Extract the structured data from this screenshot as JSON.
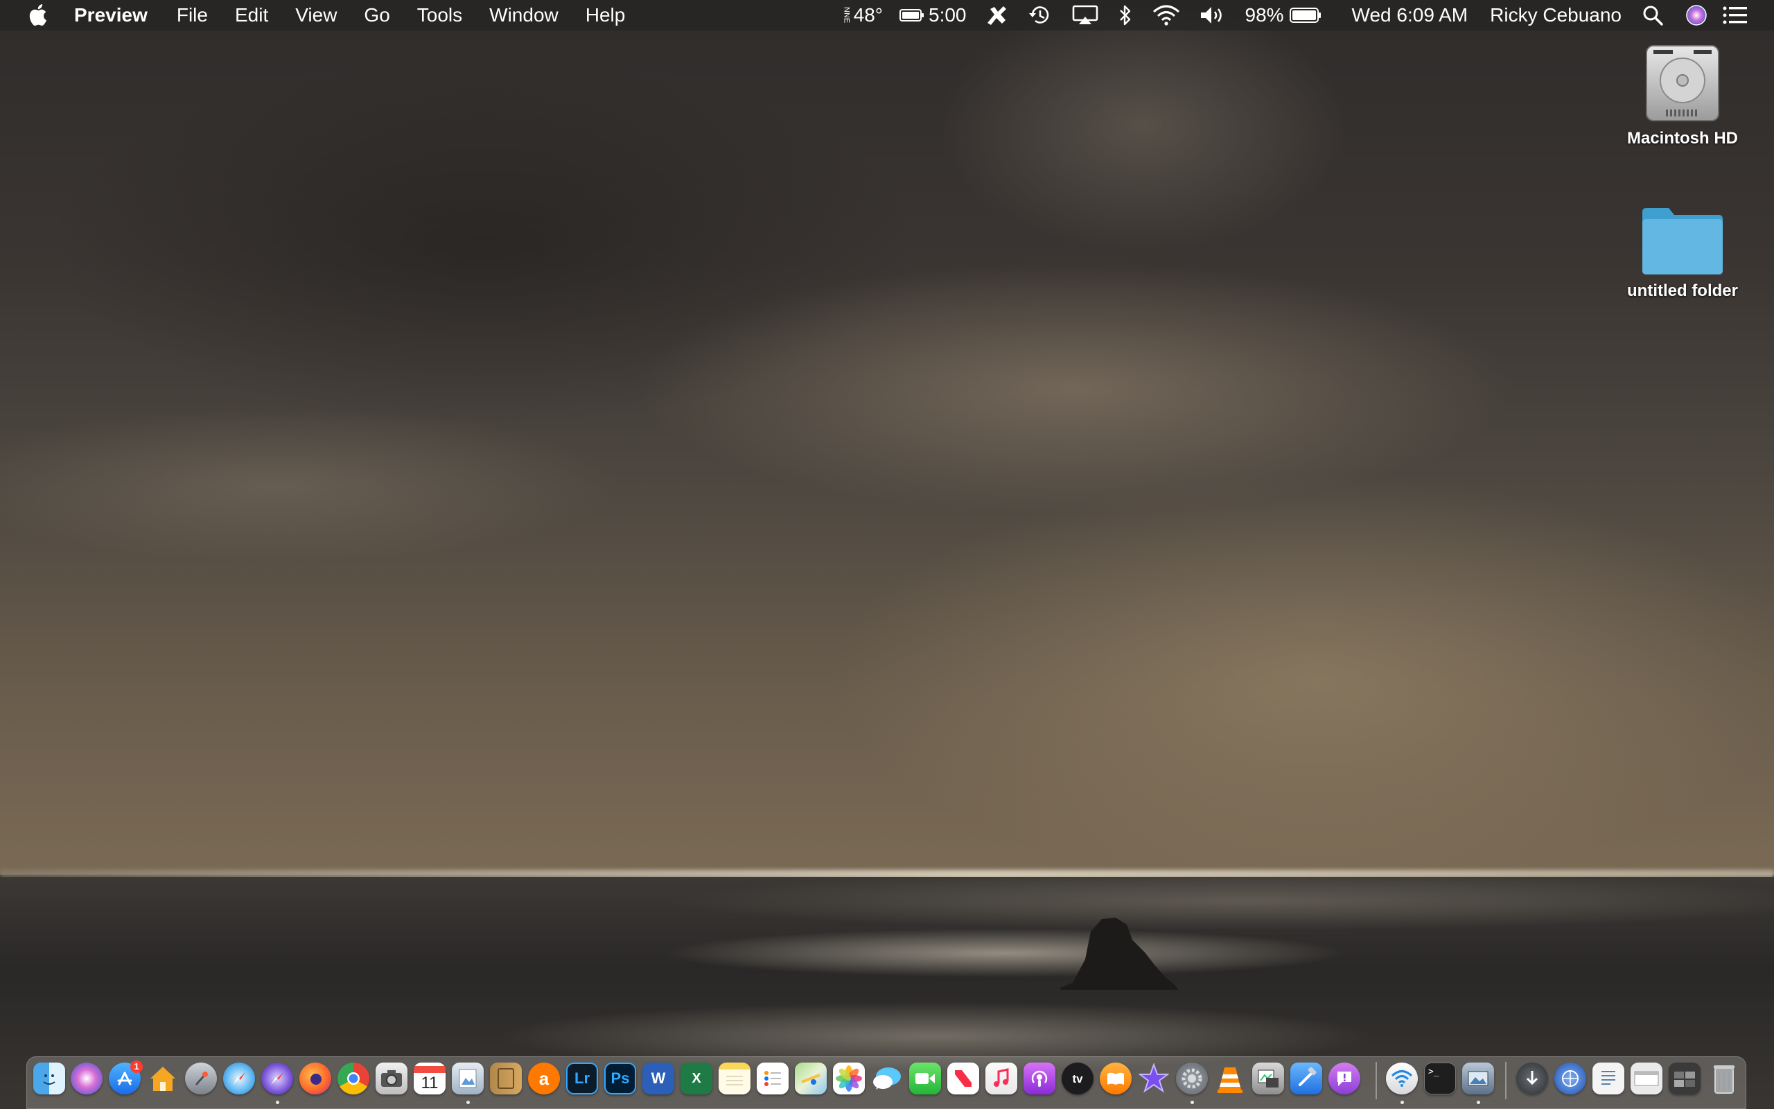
{
  "menubar": {
    "app_name": "Preview",
    "menus": [
      "File",
      "Edit",
      "View",
      "Go",
      "Tools",
      "Window",
      "Help"
    ],
    "weather_wind": "NNE",
    "temperature": "48°",
    "battery_time": "5:00",
    "battery_percent": "98%",
    "clock": "Wed 6:09 AM",
    "user": "Ricky Cebuano"
  },
  "desktop": {
    "items": [
      {
        "label": "Macintosh HD",
        "icon": "hard-drive-icon"
      },
      {
        "label": "untitled folder",
        "icon": "folder-icon"
      }
    ]
  },
  "dock": {
    "apps": [
      {
        "name": "Finder",
        "icon": "finder-icon",
        "running": true
      },
      {
        "name": "Siri",
        "icon": "siri-icon"
      },
      {
        "name": "App Store",
        "icon": "app-store-icon",
        "badge": "1"
      },
      {
        "name": "Home",
        "icon": "home-icon"
      },
      {
        "name": "Launchpad",
        "icon": "launchpad-icon"
      },
      {
        "name": "Safari",
        "icon": "safari-icon"
      },
      {
        "name": "Safari Technology Preview",
        "icon": "safari-preview-icon",
        "running": true
      },
      {
        "name": "Firefox",
        "icon": "firefox-icon"
      },
      {
        "name": "Chrome",
        "icon": "chrome-icon"
      },
      {
        "name": "Screenshot",
        "icon": "camera-icon"
      },
      {
        "name": "Calendar",
        "icon": "calendar-icon",
        "text": "11"
      },
      {
        "name": "Preview",
        "icon": "preview-icon",
        "running": true
      },
      {
        "name": "Notefile",
        "icon": "notebook-icon"
      },
      {
        "name": "Avast",
        "icon": "avast-icon",
        "text": "a"
      },
      {
        "name": "Lightroom",
        "icon": "lightroom-icon",
        "text": "Lr"
      },
      {
        "name": "Photoshop",
        "icon": "photoshop-icon",
        "text": "Ps"
      },
      {
        "name": "Word",
        "icon": "word-icon",
        "text": "W"
      },
      {
        "name": "Excel",
        "icon": "excel-icon",
        "text": "X"
      },
      {
        "name": "Notes",
        "icon": "notes-icon"
      },
      {
        "name": "Reminders",
        "icon": "reminders-icon"
      },
      {
        "name": "Maps",
        "icon": "maps-icon"
      },
      {
        "name": "Photos",
        "icon": "photos-icon"
      },
      {
        "name": "Messages",
        "icon": "messages-icon"
      },
      {
        "name": "FaceTime",
        "icon": "facetime-icon"
      },
      {
        "name": "News",
        "icon": "news-icon"
      },
      {
        "name": "Music",
        "icon": "music-icon"
      },
      {
        "name": "Podcasts",
        "icon": "podcasts-icon"
      },
      {
        "name": "TV",
        "icon": "tv-icon",
        "text": "tv"
      },
      {
        "name": "Books",
        "icon": "books-icon"
      },
      {
        "name": "iMovie",
        "icon": "imovie-icon"
      },
      {
        "name": "System Preferences",
        "icon": "gear-icon",
        "running": true
      },
      {
        "name": "VLC",
        "icon": "vlc-icon"
      },
      {
        "name": "Preview Photos",
        "icon": "image-capture-icon"
      },
      {
        "name": "Xcode",
        "icon": "xcode-icon"
      },
      {
        "name": "Feedback Assistant",
        "icon": "feedback-icon"
      },
      {
        "name": "Wireless Diagnostics",
        "icon": "wifi-icon",
        "running": true
      },
      {
        "name": "Terminal",
        "icon": "terminal-icon",
        "text": ">_"
      },
      {
        "name": "Image Capture",
        "icon": "image-viewer-icon",
        "running": true
      },
      {
        "name": "Downloads",
        "icon": "downloads-stack-icon"
      },
      {
        "name": "Network Utility",
        "icon": "network-icon"
      },
      {
        "name": "Documents",
        "icon": "documents-stack-icon"
      },
      {
        "name": "Screenshots",
        "icon": "screenshots-stack-icon"
      },
      {
        "name": "Applications",
        "icon": "applications-stack-icon"
      },
      {
        "name": "Trash",
        "icon": "trash-icon"
      }
    ]
  },
  "colors": {
    "menubar_bg": "#262422",
    "badge_red": "#ff3b30",
    "folder_blue": "#5fb6e0"
  }
}
